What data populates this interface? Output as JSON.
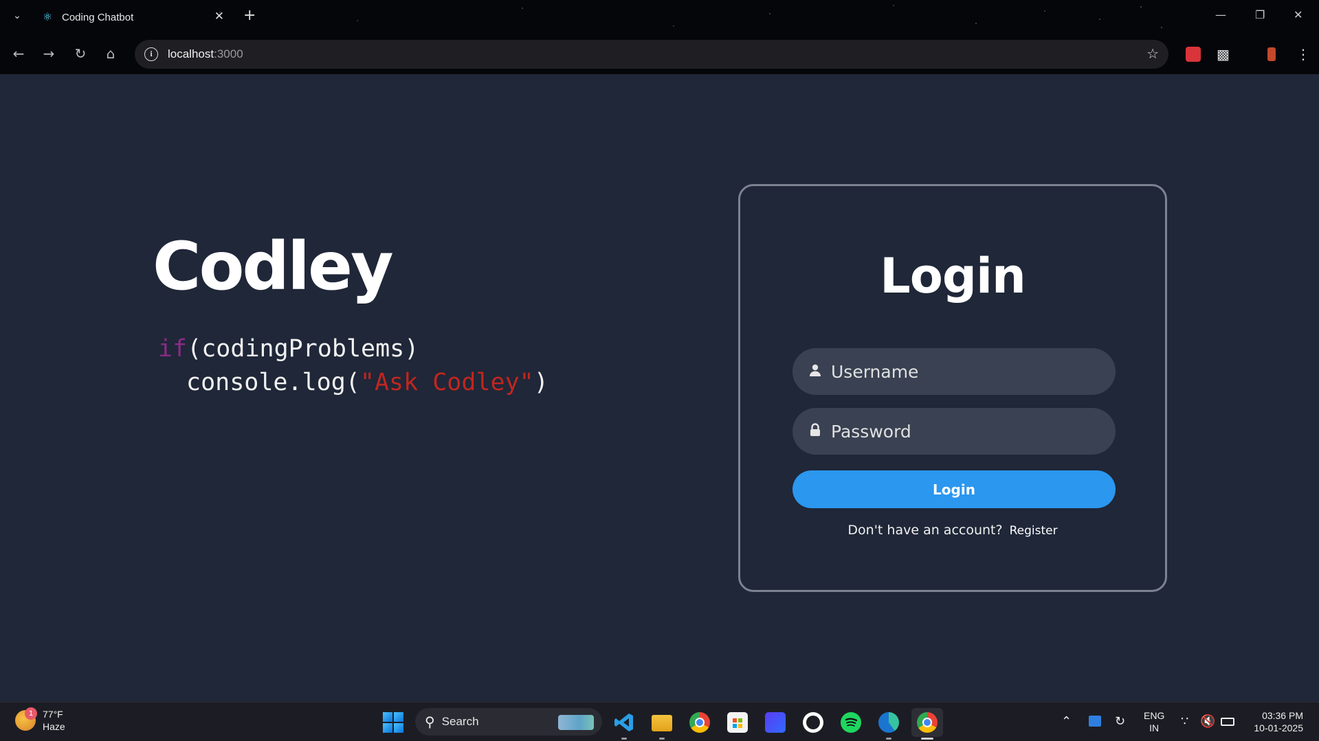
{
  "browser": {
    "tab_title": "Coding Chatbot",
    "url_host": "localhost",
    "url_port": ":3000"
  },
  "page": {
    "brand": "Codley",
    "code": {
      "keyword": "if",
      "line1_rest": "(codingProblems)",
      "line2_prefix": "console.log(",
      "line2_string": "\"Ask Codley\"",
      "line2_suffix": ")"
    },
    "login_card": {
      "title": "Login",
      "username_placeholder": "Username",
      "password_placeholder": "Password",
      "button_label": "Login",
      "signup_prompt": "Don't have an account?",
      "register_link": "Register"
    }
  },
  "taskbar": {
    "weather_temp": "77°F",
    "weather_desc": "Haze",
    "weather_badge": "1",
    "search_label": "Search",
    "lang_line1": "ENG",
    "lang_line2": "IN",
    "time": "03:36 PM",
    "date": "10-01-2025"
  },
  "colors": {
    "page_background": "#1f2738",
    "accent_button": "#2b97ef",
    "code_keyword": "#8b2b86",
    "code_string": "#c0261f"
  }
}
